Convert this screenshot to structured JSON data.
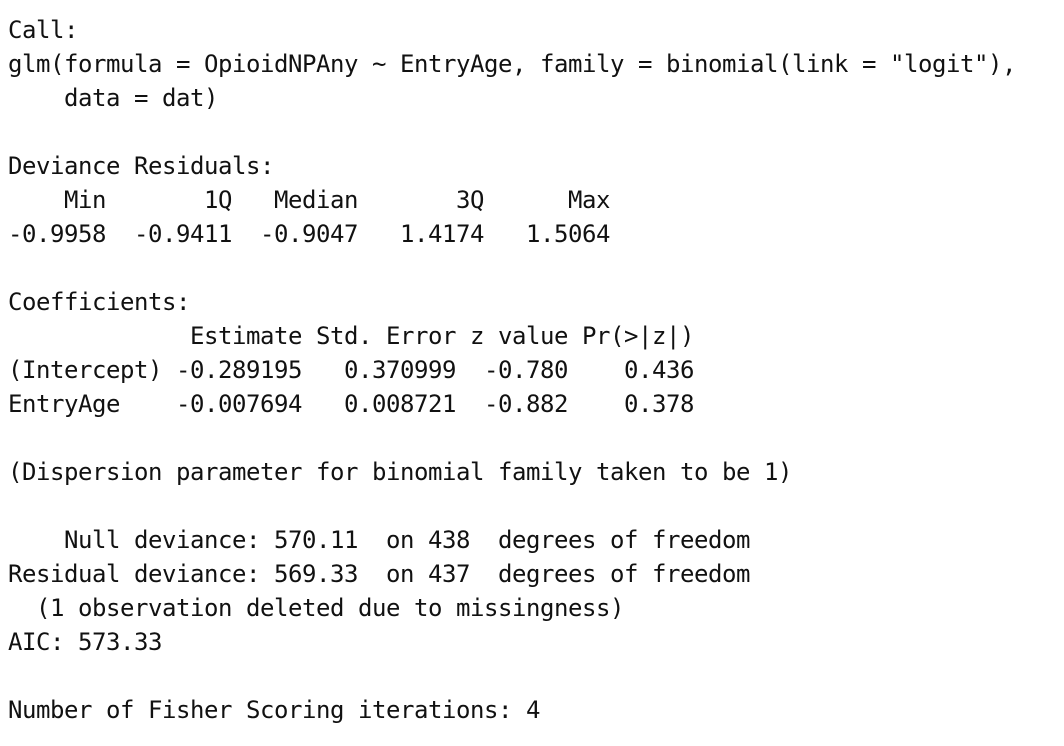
{
  "output": {
    "lines": [
      "Call:",
      "glm(formula = OpioidNPAny ~ EntryAge, family = binomial(link = \"logit\"),",
      "    data = dat)",
      "",
      "Deviance Residuals:",
      "    Min       1Q   Median       3Q      Max",
      "-0.9958  -0.9411  -0.9047   1.4174   1.5064",
      "",
      "Coefficients:",
      "             Estimate Std. Error z value Pr(>|z|)",
      "(Intercept) -0.289195   0.370999  -0.780    0.436",
      "EntryAge    -0.007694   0.008721  -0.882    0.378",
      "",
      "(Dispersion parameter for binomial family taken to be 1)",
      "",
      "    Null deviance: 570.11  on 438  degrees of freedom",
      "Residual deviance: 569.33  on 437  degrees of freedom",
      "  (1 observation deleted due to missingness)",
      "AIC: 573.33",
      "",
      "Number of Fisher Scoring iterations: 4"
    ]
  }
}
